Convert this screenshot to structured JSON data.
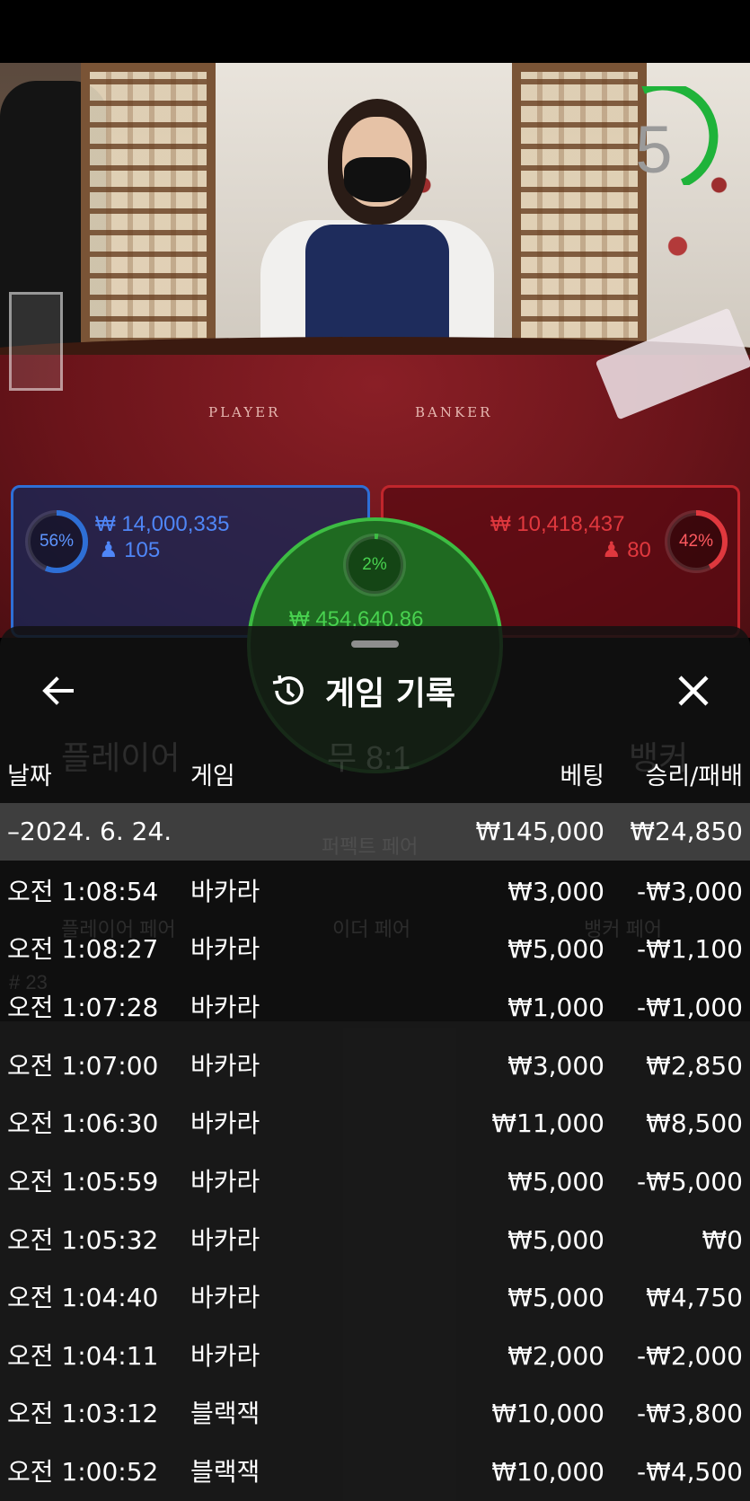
{
  "stream": {
    "countdown": "5",
    "table_labels": {
      "player": "PLAYER",
      "banker": "BANKER"
    }
  },
  "bets": {
    "player": {
      "percent_text": "56%",
      "percent": 56,
      "amount": "₩ 14,000,335",
      "players": "105",
      "color": "#2e6fd6"
    },
    "banker": {
      "percent_text": "42%",
      "percent": 42,
      "amount": "₩ 10,418,437",
      "players": "80",
      "color": "#e0383e"
    },
    "tie": {
      "percent_text": "2%",
      "percent": 2,
      "amount": "₩ 454,640.86",
      "color": "#3dbd43"
    }
  },
  "history": {
    "title": "게임 기록",
    "back_icon": "arrow-left-icon",
    "title_icon": "history-clock-icon",
    "close_icon": "close-icon",
    "columns": {
      "date": "날짜",
      "game": "게임",
      "bet": "베팅",
      "win": "승리/패배"
    },
    "date_group": {
      "date": "–2024. 6. 24.",
      "bet": "₩145,000",
      "win": "₩24,850"
    },
    "rows": [
      {
        "time": "오전 1:08:54",
        "game": "바카라",
        "bet": "₩3,000",
        "win": "-₩3,000"
      },
      {
        "time": "오전 1:08:27",
        "game": "바카라",
        "bet": "₩5,000",
        "win": "-₩1,100"
      },
      {
        "time": "오전 1:07:28",
        "game": "바카라",
        "bet": "₩1,000",
        "win": "-₩1,000"
      },
      {
        "time": "오전 1:07:00",
        "game": "바카라",
        "bet": "₩3,000",
        "win": "₩2,850"
      },
      {
        "time": "오전 1:06:30",
        "game": "바카라",
        "bet": "₩11,000",
        "win": "₩8,500"
      },
      {
        "time": "오전 1:05:59",
        "game": "바카라",
        "bet": "₩5,000",
        "win": "-₩5,000"
      },
      {
        "time": "오전 1:05:32",
        "game": "바카라",
        "bet": "₩5,000",
        "win": "₩0"
      },
      {
        "time": "오전 1:04:40",
        "game": "바카라",
        "bet": "₩5,000",
        "win": "₩4,750"
      },
      {
        "time": "오전 1:04:11",
        "game": "바카라",
        "bet": "₩2,000",
        "win": "-₩2,000"
      },
      {
        "time": "오전 1:03:12",
        "game": "블랙잭",
        "bet": "₩10,000",
        "win": "-₩3,800"
      },
      {
        "time": "오전 1:00:52",
        "game": "블랙잭",
        "bet": "₩10,000",
        "win": "-₩4,500"
      }
    ]
  },
  "behind_sheet": {
    "player_label": "플레이어",
    "tie_label": "무 8:1",
    "banker_label": "뱅커",
    "perfect_pair": "퍼펙트 페어",
    "player_pair": "플레이어 페어",
    "either_pair": "이더 페어",
    "banker_pair": "뱅커 페어",
    "round": "# 23"
  }
}
